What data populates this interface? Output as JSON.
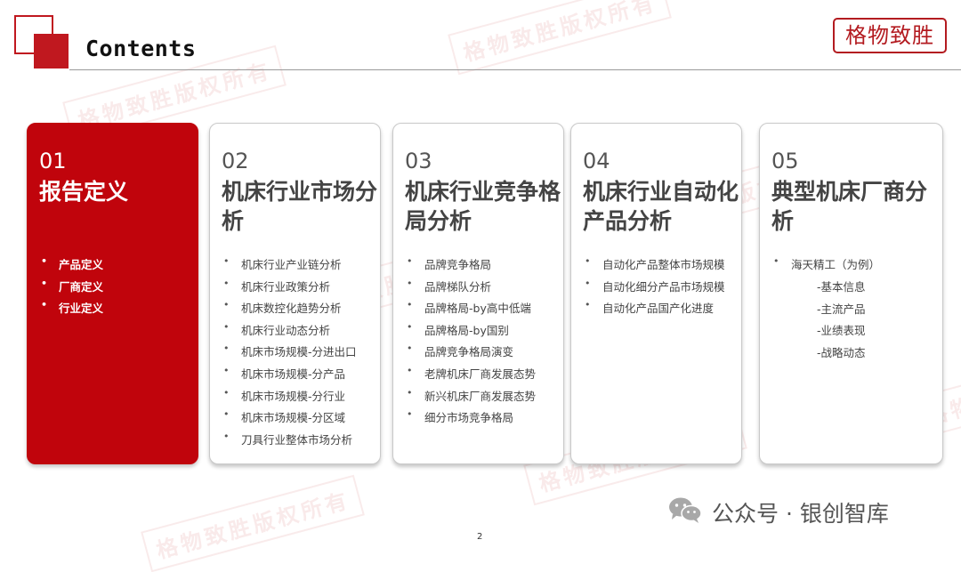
{
  "header": {
    "title": "Contents",
    "seal_text": "格物致胜"
  },
  "watermark_text": "格物致胜版权所有",
  "colors": {
    "accent": "#c0040c",
    "seal": "#b31b20"
  },
  "cards": [
    {
      "number": "01",
      "heading": "报告定义",
      "active": true,
      "items": [
        "产品定义",
        "厂商定义",
        "行业定义"
      ]
    },
    {
      "number": "02",
      "heading": "机床行业市场分析",
      "active": false,
      "items": [
        "机床行业产业链分析",
        "机床行业政策分析",
        "机床数控化趋势分析",
        "机床行业动态分析",
        "机床市场规模-分进出口",
        "机床市场规模-分产品",
        "机床市场规模-分行业",
        "机床市场规模-分区域",
        "刀具行业整体市场分析"
      ]
    },
    {
      "number": "03",
      "heading": "机床行业竞争格局分析",
      "active": false,
      "items": [
        "品牌竞争格局",
        "品牌梯队分析",
        "品牌格局-by高中低端",
        "品牌格局-by国别",
        "品牌竞争格局演变",
        "老牌机床厂商发展态势",
        "新兴机床厂商发展态势",
        "细分市场竞争格局"
      ]
    },
    {
      "number": "04",
      "heading": "机床行业自动化产品分析",
      "active": false,
      "items": [
        "自动化产品整体市场规模",
        "自动化细分产品市场规模",
        "自动化产品国产化进度"
      ]
    },
    {
      "number": "05",
      "heading": "典型机床厂商分析",
      "active": false,
      "items": [
        "海天精工（为例）"
      ],
      "sub_items": [
        "-基本信息",
        "-主流产品",
        "-业绩表现",
        "-战略动态"
      ]
    }
  ],
  "footer": {
    "brand": "公众号 · 银创智库",
    "icon": "wechat-icon",
    "page_number": "2"
  }
}
